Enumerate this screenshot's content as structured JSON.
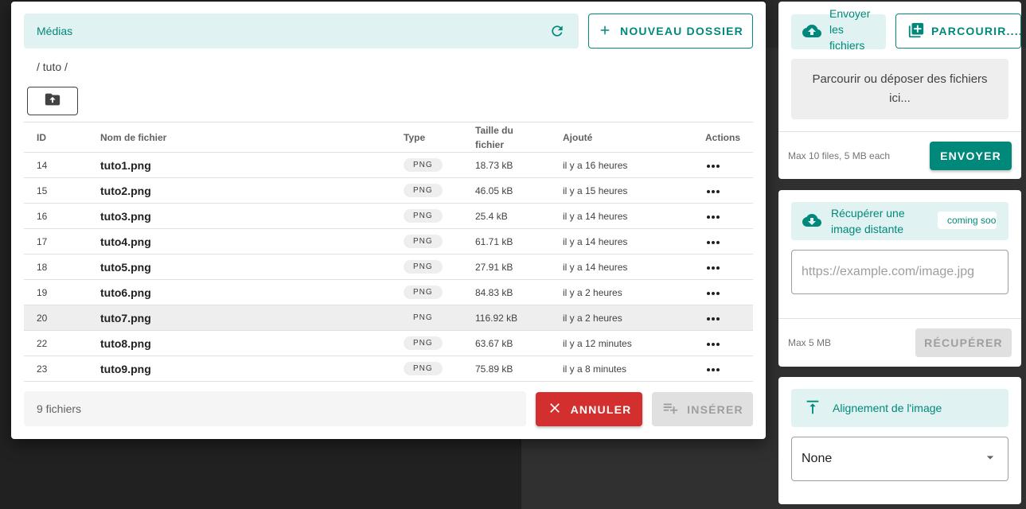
{
  "media_dialog": {
    "title": "Médias",
    "new_folder_label": "NOUVEAU DOSSIER",
    "breadcrumb": "/ tuto /",
    "table": {
      "headers": {
        "id": "ID",
        "name": "Nom de fichier",
        "type": "Type",
        "size": "Taille du fichier",
        "added": "Ajouté",
        "actions": "Actions"
      },
      "rows": [
        {
          "id": "14",
          "name": "tuto1.png",
          "type": "PNG",
          "size": "18.73 kB",
          "added": "il y a 16 heures"
        },
        {
          "id": "15",
          "name": "tuto2.png",
          "type": "PNG",
          "size": "46.05 kB",
          "added": "il y a 15 heures"
        },
        {
          "id": "16",
          "name": "tuto3.png",
          "type": "PNG",
          "size": "25.4 kB",
          "added": "il y a 14 heures"
        },
        {
          "id": "17",
          "name": "tuto4.png",
          "type": "PNG",
          "size": "61.71 kB",
          "added": "il y a 14 heures"
        },
        {
          "id": "18",
          "name": "tuto5.png",
          "type": "PNG",
          "size": "27.91 kB",
          "added": "il y a 14 heures"
        },
        {
          "id": "19",
          "name": "tuto6.png",
          "type": "PNG",
          "size": "84.83 kB",
          "added": "il y a 2 heures"
        },
        {
          "id": "20",
          "name": "tuto7.png",
          "type": "PNG",
          "size": "116.92 kB",
          "added": "il y a 2 heures"
        },
        {
          "id": "22",
          "name": "tuto8.png",
          "type": "PNG",
          "size": "63.67 kB",
          "added": "il y a 12 minutes"
        },
        {
          "id": "23",
          "name": "tuto9.png",
          "type": "PNG",
          "size": "75.89 kB",
          "added": "il y a 8 minutes"
        }
      ],
      "selected_row_id": "20"
    },
    "file_count": "9 fichiers",
    "cancel_label": "ANNULER",
    "insert_label": "INSÉRER"
  },
  "upload_card": {
    "chip_label": "Envoyer les fichiers",
    "browse_label": "PARCOURIR....",
    "dropzone_text": "Parcourir ou déposer des fichiers ici...",
    "limit_hint": "Max 10 files, 5 MB each",
    "send_label": "ENVOYER"
  },
  "remote_card": {
    "chip_label": "Récupérer une image distante",
    "badge": "coming soon",
    "url_placeholder": "https://example.com/image.jpg",
    "limit_hint": "Max 5 MB",
    "fetch_label": "RÉCUPÉRER"
  },
  "alignment_card": {
    "chip_label": "Alignement de l'image",
    "selected_value": "None"
  },
  "colors": {
    "accent": "#00897b",
    "accent_light": "#e0f2f1",
    "danger": "#d32f2f",
    "disabled": "#e0e0e0"
  },
  "icons": {
    "refresh": "refresh-icon",
    "add": "plus-icon",
    "folder_up": "folder-upload-icon",
    "more": "more-horizontal-icon",
    "close": "close-icon",
    "playlist_add": "playlist-add-icon",
    "cloud_upload": "cloud-upload-icon",
    "library_add": "library-add-icon",
    "cloud_download": "cloud-download-icon",
    "align_top": "vertical-align-top-icon",
    "dropdown": "chevron-down-icon"
  }
}
